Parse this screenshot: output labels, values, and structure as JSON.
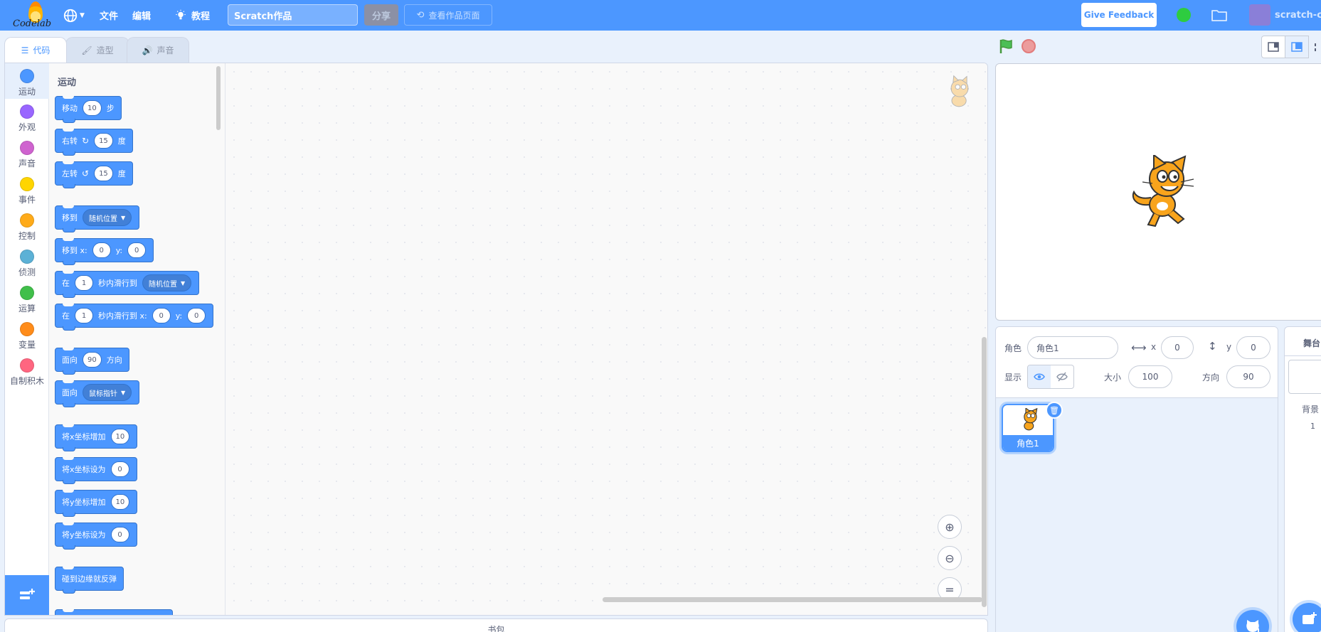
{
  "menubar": {
    "logo_text": "Codelab",
    "file": "文件",
    "edit": "编辑",
    "tutorials": "教程",
    "project_title": "Scratch作品",
    "share": "分享",
    "see_project_page": "查看作品页面",
    "give_feedback": "Give Feedback",
    "username": "scratch-cat"
  },
  "tabs": {
    "code": "代码",
    "costumes": "造型",
    "sounds": "声音"
  },
  "categories": [
    {
      "label": "运动",
      "color": "#4c97ff"
    },
    {
      "label": "外观",
      "color": "#9966ff"
    },
    {
      "label": "声音",
      "color": "#cf63cf"
    },
    {
      "label": "事件",
      "color": "#ffd500"
    },
    {
      "label": "控制",
      "color": "#ffab19"
    },
    {
      "label": "侦测",
      "color": "#5cb1d6"
    },
    {
      "label": "运算",
      "color": "#40bf4a"
    },
    {
      "label": "变量",
      "color": "#ff8c1a"
    },
    {
      "label": "自制积木",
      "color": "#ff6680"
    }
  ],
  "palette": {
    "title": "运动",
    "blocks": [
      {
        "a": "移动",
        "n1": "10",
        "b": "步"
      },
      {
        "a": "右转",
        "n1": "15",
        "b": "度"
      },
      {
        "a": "左转",
        "n1": "15",
        "b": "度"
      },
      {
        "a": "移到",
        "d1": "随机位置"
      },
      {
        "a": "移到 x:",
        "n1": "0",
        "b": "y:",
        "n2": "0"
      },
      {
        "a": "在",
        "n1": "1",
        "b": "秒内滑行到",
        "d1": "随机位置"
      },
      {
        "a": "在",
        "n1": "1",
        "b": "秒内滑行到 x:",
        "n2": "0",
        "c": "y:",
        "n3": "0"
      },
      {
        "a": "面向",
        "n1": "90",
        "b": "方向"
      },
      {
        "a": "面向",
        "d1": "鼠标指针"
      },
      {
        "a": "将x坐标增加",
        "n1": "10"
      },
      {
        "a": "将x坐标设为",
        "n1": "0"
      },
      {
        "a": "将y坐标增加",
        "n1": "10"
      },
      {
        "a": "将y坐标设为",
        "n1": "0"
      },
      {
        "a": "碰到边缘就反弹"
      }
    ]
  },
  "backpack": "书包",
  "sprite": {
    "label": "角色",
    "name": "角色1",
    "x_label": "x",
    "x": "0",
    "y_label": "y",
    "y": "0",
    "show_label": "显示",
    "size_label": "大小",
    "size": "100",
    "direction_label": "方向",
    "direction": "90",
    "thumb_name": "角色1"
  },
  "stage_pane": {
    "title": "舞台",
    "backdrops_label": "背景",
    "backdrops_count": "1"
  }
}
